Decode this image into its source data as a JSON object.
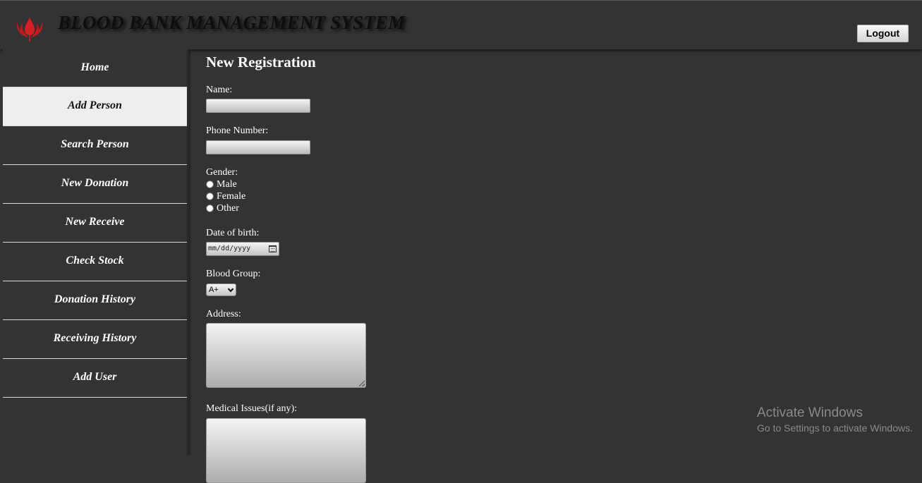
{
  "header": {
    "title": "BLOOD BANK MANAGEMENT SYSTEM",
    "logout_label": "Logout",
    "logo_icon": "blood-drop-hands-icon",
    "accent_color": "#c8161d"
  },
  "sidebar": {
    "items": [
      {
        "label": "Home",
        "active": false
      },
      {
        "label": "Add Person",
        "active": true
      },
      {
        "label": "Search Person",
        "active": false
      },
      {
        "label": "New Donation",
        "active": false
      },
      {
        "label": "New Receive",
        "active": false
      },
      {
        "label": "Check Stock",
        "active": false
      },
      {
        "label": "Donation History",
        "active": false
      },
      {
        "label": "Receiving History",
        "active": false
      },
      {
        "label": "Add User",
        "active": false
      }
    ]
  },
  "form": {
    "title": "New Registration",
    "name_label": "Name:",
    "name_value": "",
    "phone_label": "Phone Number:",
    "phone_value": "",
    "gender_label": "Gender:",
    "gender_options": [
      "Male",
      "Female",
      "Other"
    ],
    "dob_label": "Date of birth:",
    "dob_placeholder": "mm/dd/yyyy",
    "blood_group_label": "Blood Group:",
    "blood_group_selected": "A+",
    "address_label": "Address:",
    "address_value": "",
    "medical_label": "Medical Issues(if any):",
    "medical_value": ""
  },
  "watermark": {
    "title": "Activate Windows",
    "subtitle": "Go to Settings to activate Windows."
  }
}
